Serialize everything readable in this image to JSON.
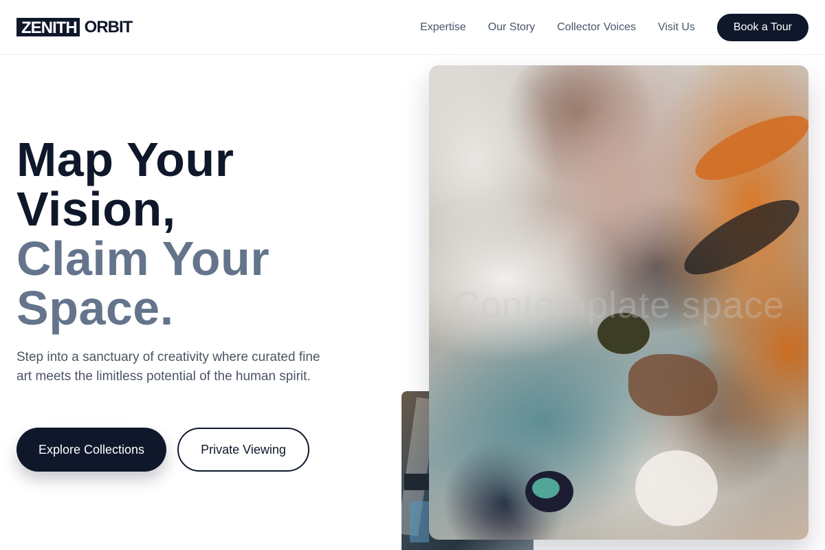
{
  "brand": {
    "mark": "ZENITH",
    "rest": "ORBIT"
  },
  "nav": {
    "links": [
      "Expertise",
      "Our Story",
      "Collector Voices",
      "Visit Us"
    ],
    "cta": "Book a Tour"
  },
  "hero": {
    "title_line1": "Map Your",
    "title_line2": "Vision,",
    "title_line3": "Claim Your",
    "title_line4": "Space.",
    "description": "Step into a sanctuary of creativity where curated fine art meets the limitless potential of the human spirit.",
    "primary_button": "Explore Collections",
    "secondary_button": "Private Viewing"
  },
  "artwork": {
    "overlay_text": "Contemplate space"
  },
  "colors": {
    "brand_dark": "#0f172a",
    "muted_heading": "#64748b",
    "body_text": "#4b5563",
    "nav_text": "#475569"
  }
}
